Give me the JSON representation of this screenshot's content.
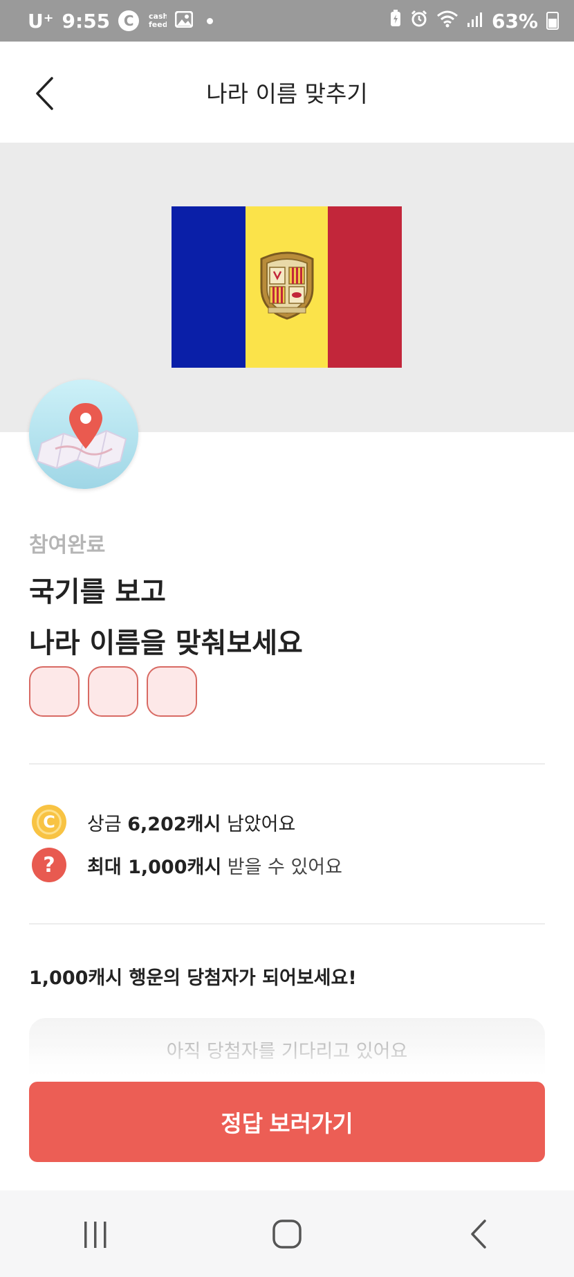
{
  "status_bar": {
    "carrier": "U⁺",
    "time": "9:55",
    "cash_icon_glyph": "C",
    "cash_feed_text": "cash\nfeed",
    "battery_percent": "63%"
  },
  "header": {
    "title": "나라 이름 맞추기"
  },
  "flag": {
    "colors": [
      "#0a1fa8",
      "#fbe34a",
      "#c2263a"
    ]
  },
  "quiz": {
    "status_label": "참여완료",
    "question_line1": "국기를 보고",
    "question_line2": "나라 이름을 맞춰보세요",
    "answer_box_count": 3
  },
  "info": {
    "coin_icon_glyph": "C",
    "prize_prefix": "상금 ",
    "prize_amount": "6,202캐시",
    "prize_suffix": " 남았어요",
    "help_icon_glyph": "?",
    "max_prefix": "최대 1,000캐시",
    "max_suffix": " 받을 수 있어요"
  },
  "lucky": {
    "title": "1,000캐시 행운의 당첨자가 되어보세요!",
    "waiting_text": "아직 당첨자를 기다리고 있어요"
  },
  "cta": {
    "label": "정답 보러가기"
  },
  "colors": {
    "accent": "#ec5e55",
    "coin": "#f8c343",
    "help": "#e85a50"
  }
}
